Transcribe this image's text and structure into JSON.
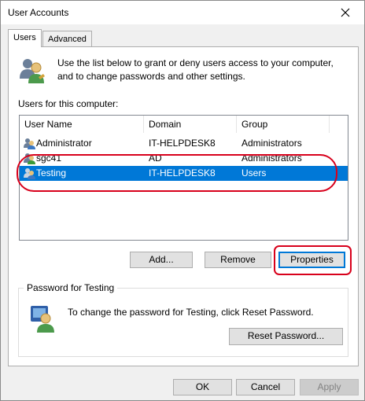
{
  "window": {
    "title": "User Accounts"
  },
  "tabs": [
    {
      "label": "Users",
      "active": true
    },
    {
      "label": "Advanced",
      "active": false
    }
  ],
  "info": {
    "text": "Use the list below to grant or deny users access to your computer, and to change passwords and other settings."
  },
  "users_label": "Users for this computer:",
  "table": {
    "columns": [
      "User Name",
      "Domain",
      "Group"
    ],
    "rows": [
      {
        "name": "Administrator",
        "domain": "IT-HELPDESK8",
        "group": "Administrators",
        "selected": false
      },
      {
        "name": "sgc41",
        "domain": "AD",
        "group": "Administrators",
        "selected": false
      },
      {
        "name": "Testing",
        "domain": "IT-HELPDESK8",
        "group": "Users",
        "selected": true
      }
    ]
  },
  "buttons": {
    "add": "Add...",
    "remove": "Remove",
    "properties": "Properties",
    "reset_password": "Reset Password...",
    "ok": "OK",
    "cancel": "Cancel",
    "apply": "Apply"
  },
  "password_group": {
    "title": "Password for Testing",
    "text": "To change the password for Testing, click Reset Password."
  },
  "colors": {
    "selection": "#0078d7",
    "annotation": "#d8001b"
  },
  "icons": [
    "users-icon",
    "user-icon",
    "password-user-icon",
    "close-icon"
  ]
}
